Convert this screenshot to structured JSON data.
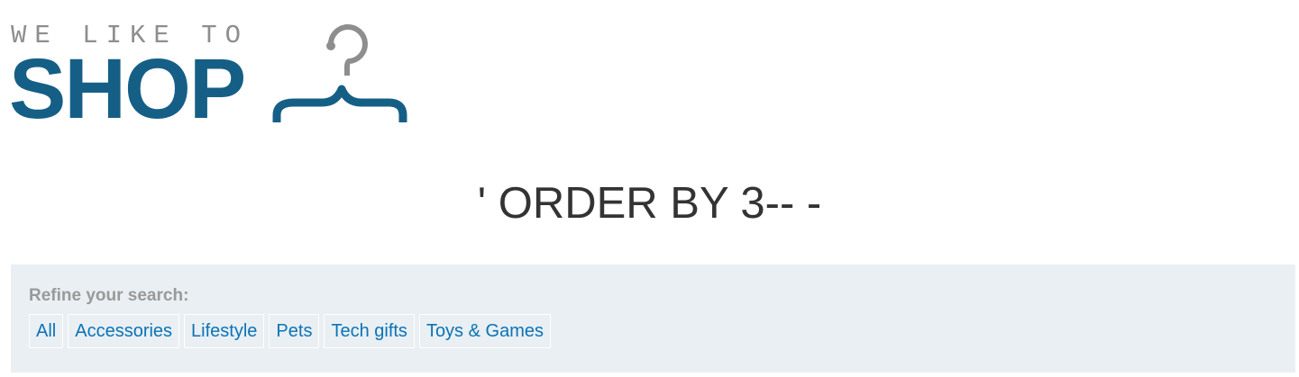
{
  "logo": {
    "tagline": "WE LIKE TO",
    "wordmark": "SHOP",
    "icon": "hanger-icon",
    "colors": {
      "wordmark": "#155f86",
      "tagline": "#8e8e8e",
      "hanger_hook": "#8e8e8e",
      "hanger_body": "#155f86"
    }
  },
  "page": {
    "title": "' ORDER BY 3-- -"
  },
  "filters": {
    "heading": "Refine your search:",
    "categories": [
      {
        "label": "All"
      },
      {
        "label": "Accessories"
      },
      {
        "label": "Lifestyle"
      },
      {
        "label": "Pets"
      },
      {
        "label": "Tech gifts"
      },
      {
        "label": "Toys & Games"
      }
    ],
    "colors": {
      "panel_background": "#e9eff2",
      "link": "#0a73b7",
      "heading": "#999999"
    }
  }
}
